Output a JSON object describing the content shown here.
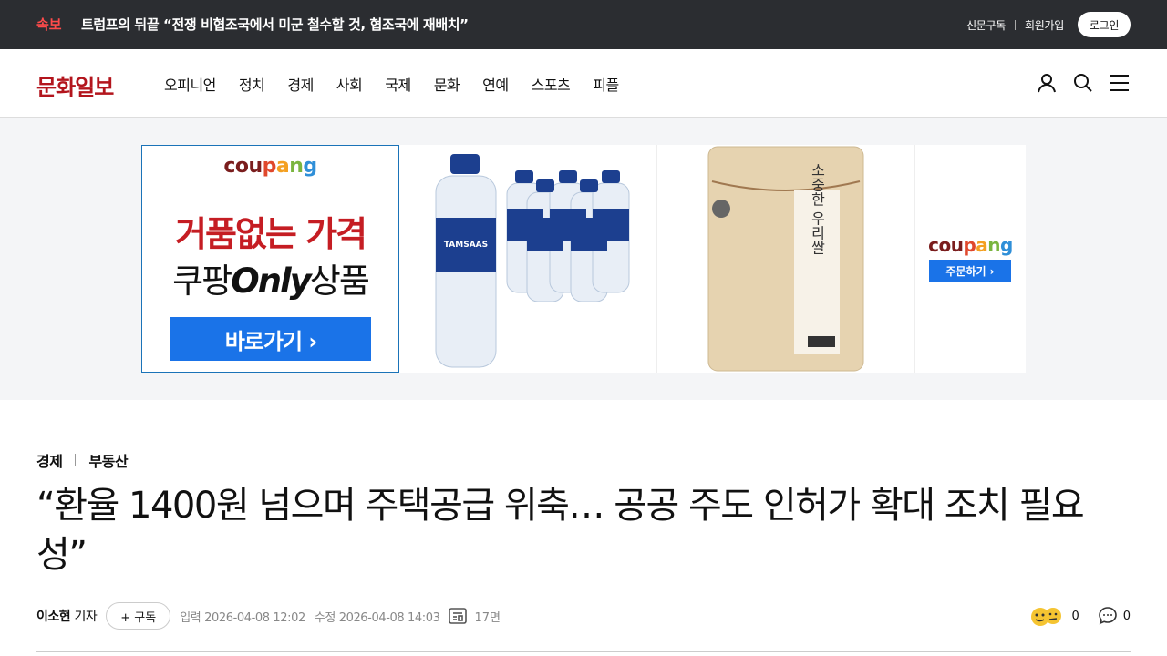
{
  "breaking": {
    "tag": "속보",
    "headline": "트럼프의 뒤끝 “전쟁 비협조국에서 미군 철수할 것, 협조국에 재배치”"
  },
  "util": {
    "subscribe": "신문구독",
    "signup": "회원가입",
    "login": "로그인"
  },
  "header": {
    "logo": "문화일보",
    "nav": [
      "오피니언",
      "정치",
      "경제",
      "사회",
      "국제",
      "문화",
      "연예",
      "스포츠",
      "피플"
    ],
    "icons": [
      "user-icon",
      "search-icon",
      "menu-icon"
    ]
  },
  "ad": {
    "brand": "coupang",
    "line1": "거품없는 가격",
    "line2_a": "쿠팡",
    "line2_b": "Only",
    "line2_c": "상품",
    "cta": "바로가기 ›",
    "order": "주문하기 ›",
    "water_label": "TAMSAAS",
    "rice_label": "소중한 우리쌀"
  },
  "article": {
    "category": "경제",
    "subcategory": "부동산",
    "title": "“환율 1400원 넘으며 주택공급 위축… 공공 주도 인허가 확대 조치 필요성”",
    "reporter": "이소현",
    "reporter_suffix": "기자",
    "subscribe_btn": "+ 구독",
    "input_date": "입력 2026-04-08 12:02",
    "modified_date": "수정 2026-04-08 14:03",
    "page": "17면",
    "reactions": "0",
    "comments": "0"
  },
  "colors": {
    "brand_red": "#b3151d",
    "breaking_bg": "#2b2d31",
    "breaking_tag": "#ff4b4b",
    "cta_blue": "#1a73e8"
  }
}
